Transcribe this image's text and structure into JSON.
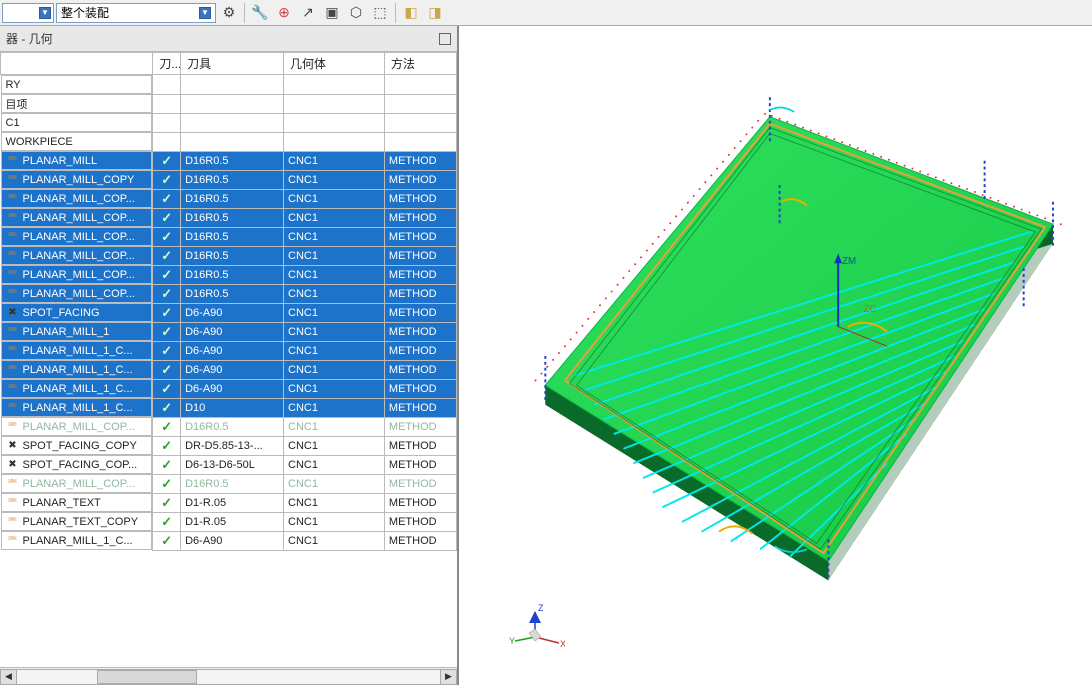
{
  "toolbar": {
    "assembly_mode": "整个装配"
  },
  "panel": {
    "title": "器 - 几何"
  },
  "columns": {
    "col0": "",
    "col1": "刀...",
    "col2": "刀具",
    "col3": "几何体",
    "col4": "方法"
  },
  "rows": [
    {
      "name": "RY",
      "chk": "",
      "tool": "",
      "geo": "",
      "method": "",
      "kind": "plain",
      "icon": "none"
    },
    {
      "name": "目项",
      "chk": "",
      "tool": "",
      "geo": "",
      "method": "",
      "kind": "plain",
      "icon": "none"
    },
    {
      "name": "C1",
      "chk": "",
      "tool": "",
      "geo": "",
      "method": "",
      "kind": "plain",
      "icon": "none"
    },
    {
      "name": "WORKPIECE",
      "chk": "",
      "tool": "",
      "geo": "",
      "method": "",
      "kind": "plain",
      "icon": "none"
    },
    {
      "name": "PLANAR_MILL",
      "chk": "✓",
      "tool": "D16R0.5",
      "geo": "CNC1",
      "method": "METHOD",
      "kind": "sel",
      "icon": "mill"
    },
    {
      "name": "PLANAR_MILL_COPY",
      "chk": "✓",
      "tool": "D16R0.5",
      "geo": "CNC1",
      "method": "METHOD",
      "kind": "sel",
      "icon": "mill"
    },
    {
      "name": "PLANAR_MILL_COP...",
      "chk": "✓",
      "tool": "D16R0.5",
      "geo": "CNC1",
      "method": "METHOD",
      "kind": "sel",
      "icon": "mill"
    },
    {
      "name": "PLANAR_MILL_COP...",
      "chk": "✓",
      "tool": "D16R0.5",
      "geo": "CNC1",
      "method": "METHOD",
      "kind": "sel",
      "icon": "mill"
    },
    {
      "name": "PLANAR_MILL_COP...",
      "chk": "✓",
      "tool": "D16R0.5",
      "geo": "CNC1",
      "method": "METHOD",
      "kind": "sel",
      "icon": "mill"
    },
    {
      "name": "PLANAR_MILL_COP...",
      "chk": "✓",
      "tool": "D16R0.5",
      "geo": "CNC1",
      "method": "METHOD",
      "kind": "sel",
      "icon": "mill"
    },
    {
      "name": "PLANAR_MILL_COP...",
      "chk": "✓",
      "tool": "D16R0.5",
      "geo": "CNC1",
      "method": "METHOD",
      "kind": "sel",
      "icon": "mill"
    },
    {
      "name": "PLANAR_MILL_COP...",
      "chk": "✓",
      "tool": "D16R0.5",
      "geo": "CNC1",
      "method": "METHOD",
      "kind": "sel",
      "icon": "mill"
    },
    {
      "name": "SPOT_FACING",
      "chk": "✓",
      "tool": "D6-A90",
      "geo": "CNC1",
      "method": "METHOD",
      "kind": "sel",
      "icon": "spot"
    },
    {
      "name": "PLANAR_MILL_1",
      "chk": "✓",
      "tool": "D6-A90",
      "geo": "CNC1",
      "method": "METHOD",
      "kind": "sel",
      "icon": "mill"
    },
    {
      "name": "PLANAR_MILL_1_C...",
      "chk": "✓",
      "tool": "D6-A90",
      "geo": "CNC1",
      "method": "METHOD",
      "kind": "sel",
      "icon": "mill"
    },
    {
      "name": "PLANAR_MILL_1_C...",
      "chk": "✓",
      "tool": "D6-A90",
      "geo": "CNC1",
      "method": "METHOD",
      "kind": "sel",
      "icon": "mill"
    },
    {
      "name": "PLANAR_MILL_1_C...",
      "chk": "✓",
      "tool": "D6-A90",
      "geo": "CNC1",
      "method": "METHOD",
      "kind": "sel",
      "icon": "mill"
    },
    {
      "name": "PLANAR_MILL_1_C...",
      "chk": "✓",
      "tool": "D10",
      "geo": "CNC1",
      "method": "METHOD",
      "kind": "sel",
      "icon": "mill"
    },
    {
      "name": "PLANAR_MILL_COP...",
      "chk": "✓",
      "tool": "D16R0.5",
      "geo": "CNC1",
      "method": "METHOD",
      "kind": "inactive",
      "icon": "mill"
    },
    {
      "name": "SPOT_FACING_COPY",
      "chk": "✓",
      "tool": "DR-D5.85-13-...",
      "geo": "CNC1",
      "method": "METHOD",
      "kind": "plain",
      "icon": "spot"
    },
    {
      "name": "SPOT_FACING_COP...",
      "chk": "✓",
      "tool": "D6-13-D6-50L",
      "geo": "CNC1",
      "method": "METHOD",
      "kind": "plain",
      "icon": "spot"
    },
    {
      "name": "PLANAR_MILL_COP...",
      "chk": "✓",
      "tool": "D16R0.5",
      "geo": "CNC1",
      "method": "METHOD",
      "kind": "inactive",
      "icon": "mill"
    },
    {
      "name": "PLANAR_TEXT",
      "chk": "✓",
      "tool": "D1-R.05",
      "geo": "CNC1",
      "method": "METHOD",
      "kind": "plain",
      "icon": "mill"
    },
    {
      "name": "PLANAR_TEXT_COPY",
      "chk": "✓",
      "tool": "D1-R.05",
      "geo": "CNC1",
      "method": "METHOD",
      "kind": "plain",
      "icon": "mill"
    },
    {
      "name": "PLANAR_MILL_1_C...",
      "chk": "✓",
      "tool": "D6-A90",
      "geo": "CNC1",
      "method": "METHOD",
      "kind": "plain",
      "icon": "mill"
    }
  ],
  "axes": {
    "x": "X",
    "y": "Y",
    "z": "Z",
    "zm": "ZM",
    "zc": "ZC"
  }
}
